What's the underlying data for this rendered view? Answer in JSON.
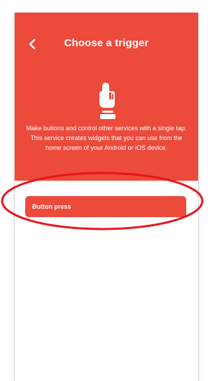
{
  "header": {
    "title": "Choose a trigger",
    "back_icon": "chevron-left-icon",
    "hero_icon": "tap-button-icon",
    "description": "Make buttons and control other services with a single tap. This service creates widgets that you can use from the home screen of your Android or iOS device."
  },
  "triggers": [
    {
      "label": "Button press"
    }
  ],
  "colors": {
    "brand": "#ec4a3b",
    "text_on_brand": "#ffffff",
    "annotation": "#e8141b"
  }
}
